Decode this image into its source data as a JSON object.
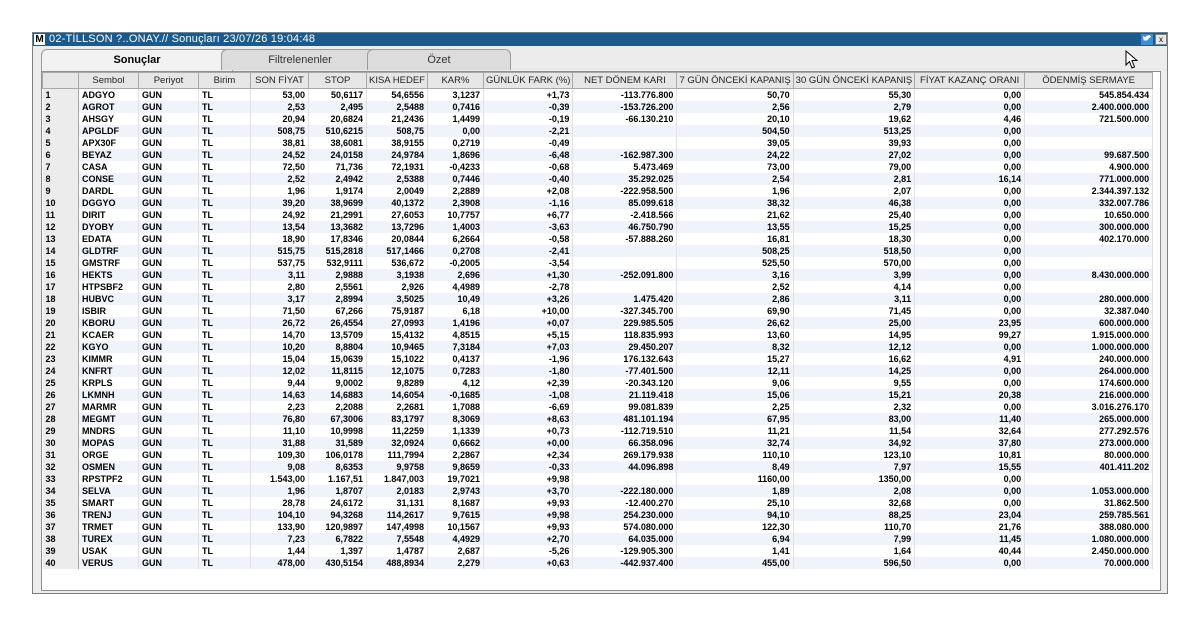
{
  "window": {
    "logo": "M",
    "title": "02-TİLLSON ?..ONAY.// Sonuçları  23/07/26 19:04:48",
    "close": "x"
  },
  "tabs": [
    {
      "label": "Sonuçlar",
      "active": true
    },
    {
      "label": "Filtrelenenler",
      "active": false
    },
    {
      "label": "Özet",
      "active": false
    }
  ],
  "columns": [
    "",
    "Sembol",
    "Periyot",
    "Birim",
    "SON FİYAT",
    "STOP",
    "KISA HEDEF",
    "KAR%",
    "GÜNLÜK FARK (%)",
    "NET DÖNEM KARI",
    "7 GÜN ÖNCEKİ KAPANIŞ",
    "30 GÜN ÖNCEKİ KAPANIŞ",
    "FİYAT KAZANÇ ORANI",
    "ÖDENMİŞ SERMAYE"
  ],
  "rows": [
    [
      "1",
      "ADGYO",
      "GUN",
      "TL",
      "53,00",
      "50,6117",
      "54,6556",
      "3,1237",
      "+1,73",
      "-113.776.800",
      "50,70",
      "55,30",
      "0,00",
      "545.854.434"
    ],
    [
      "2",
      "AGROT",
      "GUN",
      "TL",
      "2,53",
      "2,495",
      "2,5488",
      "0,7416",
      "-0,39",
      "-153.726.200",
      "2,56",
      "2,79",
      "0,00",
      "2.400.000.000"
    ],
    [
      "3",
      "AHSGY",
      "GUN",
      "TL",
      "20,94",
      "20,6824",
      "21,2436",
      "1,4499",
      "-0,19",
      "-66.130.210",
      "20,10",
      "19,62",
      "4,46",
      "721.500.000"
    ],
    [
      "4",
      "APGLDF",
      "GUN",
      "TL",
      "508,75",
      "510,6215",
      "508,75",
      "0,00",
      "-2,21",
      "",
      "504,50",
      "513,25",
      "0,00",
      ""
    ],
    [
      "5",
      "APX30F",
      "GUN",
      "TL",
      "38,81",
      "38,6081",
      "38,9155",
      "0,2719",
      "-0,49",
      "",
      "39,05",
      "39,93",
      "0,00",
      ""
    ],
    [
      "6",
      "BEYAZ",
      "GUN",
      "TL",
      "24,52",
      "24,0158",
      "24,9784",
      "1,8696",
      "-6,48",
      "-162.987.300",
      "24,22",
      "27,02",
      "0,00",
      "99.687.500"
    ],
    [
      "7",
      "CASA",
      "GUN",
      "TL",
      "72,50",
      "71,736",
      "72,1931",
      "-0,4233",
      "-0,68",
      "5.473.469",
      "73,00",
      "79,00",
      "0,00",
      "4.900.000"
    ],
    [
      "8",
      "CONSE",
      "GUN",
      "TL",
      "2,52",
      "2,4942",
      "2,5388",
      "0,7446",
      "-0,40",
      "35.292.025",
      "2,54",
      "2,81",
      "16,14",
      "771.000.000"
    ],
    [
      "9",
      "DARDL",
      "GUN",
      "TL",
      "1,96",
      "1,9174",
      "2,0049",
      "2,2889",
      "+2,08",
      "-222.958.500",
      "1,96",
      "2,07",
      "0,00",
      "2.344.397.132"
    ],
    [
      "10",
      "DGGYO",
      "GUN",
      "TL",
      "39,20",
      "38,9699",
      "40,1372",
      "2,3908",
      "-1,16",
      "85.099.618",
      "38,32",
      "46,38",
      "0,00",
      "332.007.786"
    ],
    [
      "11",
      "DIRIT",
      "GUN",
      "TL",
      "24,92",
      "21,2991",
      "27,6053",
      "10,7757",
      "+6,77",
      "-2.418.566",
      "21,62",
      "25,40",
      "0,00",
      "10.650.000"
    ],
    [
      "12",
      "DYOBY",
      "GUN",
      "TL",
      "13,54",
      "13,3682",
      "13,7296",
      "1,4003",
      "-3,63",
      "46.750.790",
      "13,55",
      "15,25",
      "0,00",
      "300.000.000"
    ],
    [
      "13",
      "EDATA",
      "GUN",
      "TL",
      "18,90",
      "17,8346",
      "20,0844",
      "6,2664",
      "-0,58",
      "-57.888.260",
      "16,81",
      "18,30",
      "0,00",
      "402.170.000"
    ],
    [
      "14",
      "GLDTRF",
      "GUN",
      "TL",
      "515,75",
      "515,2818",
      "517,1466",
      "0,2708",
      "-2,41",
      "",
      "508,25",
      "518,50",
      "0,00",
      ""
    ],
    [
      "15",
      "GMSTRF",
      "GUN",
      "TL",
      "537,75",
      "532,9111",
      "536,672",
      "-0,2005",
      "-3,54",
      "",
      "525,50",
      "570,00",
      "0,00",
      ""
    ],
    [
      "16",
      "HEKTS",
      "GUN",
      "TL",
      "3,11",
      "2,9888",
      "3,1938",
      "2,696",
      "+1,30",
      "-252.091.800",
      "3,16",
      "3,99",
      "0,00",
      "8.430.000.000"
    ],
    [
      "17",
      "HTPSBF2",
      "GUN",
      "TL",
      "2,80",
      "2,5561",
      "2,926",
      "4,4989",
      "-2,78",
      "",
      "2,52",
      "4,14",
      "0,00",
      ""
    ],
    [
      "18",
      "HUBVC",
      "GUN",
      "TL",
      "3,17",
      "2,8994",
      "3,5025",
      "10,49",
      "+3,26",
      "1.475.420",
      "2,86",
      "3,11",
      "0,00",
      "280.000.000"
    ],
    [
      "19",
      "ISBIR",
      "GUN",
      "TL",
      "71,50",
      "67,266",
      "75,9187",
      "6,18",
      "+10,00",
      "-327.345.700",
      "69,90",
      "71,45",
      "0,00",
      "32.387.040"
    ],
    [
      "20",
      "KBORU",
      "GUN",
      "TL",
      "26,72",
      "26,4554",
      "27,0993",
      "1,4196",
      "+0,07",
      "229.985.505",
      "26,62",
      "25,00",
      "23,95",
      "600.000.000"
    ],
    [
      "21",
      "KCAER",
      "GUN",
      "TL",
      "14,70",
      "13,5709",
      "15,4132",
      "4,8515",
      "+5,15",
      "118.835.993",
      "13,60",
      "14,95",
      "99,27",
      "1.915.000.000"
    ],
    [
      "22",
      "KGYO",
      "GUN",
      "TL",
      "10,20",
      "8,8804",
      "10,9465",
      "7,3184",
      "+7,03",
      "29.450.207",
      "8,32",
      "12,12",
      "0,00",
      "1.000.000.000"
    ],
    [
      "23",
      "KIMMR",
      "GUN",
      "TL",
      "15,04",
      "15,0639",
      "15,1022",
      "0,4137",
      "-1,96",
      "176.132.643",
      "15,27",
      "16,62",
      "4,91",
      "240.000.000"
    ],
    [
      "24",
      "KNFRT",
      "GUN",
      "TL",
      "12,02",
      "11,8115",
      "12,1075",
      "0,7283",
      "-1,80",
      "-77.401.500",
      "12,11",
      "14,25",
      "0,00",
      "264.000.000"
    ],
    [
      "25",
      "KRPLS",
      "GUN",
      "TL",
      "9,44",
      "9,0002",
      "9,8289",
      "4,12",
      "+2,39",
      "-20.343.120",
      "9,06",
      "9,55",
      "0,00",
      "174.600.000"
    ],
    [
      "26",
      "LKMNH",
      "GUN",
      "TL",
      "14,63",
      "14,6883",
      "14,6054",
      "-0,1685",
      "-1,08",
      "21.119.418",
      "15,06",
      "15,21",
      "20,38",
      "216.000.000"
    ],
    [
      "27",
      "MARMR",
      "GUN",
      "TL",
      "2,23",
      "2,2088",
      "2,2681",
      "1,7088",
      "-6,69",
      "99.081.839",
      "2,25",
      "2,32",
      "0,00",
      "3.016.276.170"
    ],
    [
      "28",
      "MEGMT",
      "GUN",
      "TL",
      "76,80",
      "67,3006",
      "83,1797",
      "8,3069",
      "+8,63",
      "481.101.194",
      "67,95",
      "83,00",
      "11,40",
      "265.000.000"
    ],
    [
      "29",
      "MNDRS",
      "GUN",
      "TL",
      "11,10",
      "10,9998",
      "11,2259",
      "1,1339",
      "+0,73",
      "-112.719.510",
      "11,21",
      "11,54",
      "32,64",
      "277.292.576"
    ],
    [
      "30",
      "MOPAS",
      "GUN",
      "TL",
      "31,88",
      "31,589",
      "32,0924",
      "0,6662",
      "+0,00",
      "66.358.096",
      "32,74",
      "34,92",
      "37,80",
      "273.000.000"
    ],
    [
      "31",
      "ORGE",
      "GUN",
      "TL",
      "109,30",
      "106,0178",
      "111,7994",
      "2,2867",
      "+2,34",
      "269.179.938",
      "110,10",
      "123,10",
      "10,81",
      "80.000.000"
    ],
    [
      "32",
      "OSMEN",
      "GUN",
      "TL",
      "9,08",
      "8,6353",
      "9,9758",
      "9,8659",
      "-0,33",
      "44.096.898",
      "8,49",
      "7,97",
      "15,55",
      "401.411.202"
    ],
    [
      "33",
      "RPSTPF2",
      "GUN",
      "TL",
      "1.543,00",
      "1.167,51",
      "1.847,003",
      "19,7021",
      "+9,98",
      "",
      "1160,00",
      "1350,00",
      "0,00",
      ""
    ],
    [
      "34",
      "SELVA",
      "GUN",
      "TL",
      "1,96",
      "1,8707",
      "2,0183",
      "2,9743",
      "+3,70",
      "-222.180.000",
      "1,89",
      "2,08",
      "0,00",
      "1.053.000.000"
    ],
    [
      "35",
      "SMART",
      "GUN",
      "TL",
      "28,78",
      "24,6172",
      "31,131",
      "8,1687",
      "+9,93",
      "-12.400.270",
      "25,10",
      "32,68",
      "0,00",
      "31.862.500"
    ],
    [
      "36",
      "TRENJ",
      "GUN",
      "TL",
      "104,10",
      "94,3268",
      "114,2617",
      "9,7615",
      "+9,98",
      "254.230.000",
      "94,10",
      "88,25",
      "23,04",
      "259.785.561"
    ],
    [
      "37",
      "TRMET",
      "GUN",
      "TL",
      "133,90",
      "120,9897",
      "147,4998",
      "10,1567",
      "+9,93",
      "574.080.000",
      "122,30",
      "110,70",
      "21,76",
      "388.080.000"
    ],
    [
      "38",
      "TUREX",
      "GUN",
      "TL",
      "7,23",
      "6,7822",
      "7,5548",
      "4,4929",
      "+2,70",
      "64.035.000",
      "6,94",
      "7,99",
      "11,45",
      "1.080.000.000"
    ],
    [
      "39",
      "USAK",
      "GUN",
      "TL",
      "1,44",
      "1,397",
      "1,4787",
      "2,687",
      "-5,26",
      "-129.905.300",
      "1,41",
      "1,64",
      "40,44",
      "2.450.000.000"
    ],
    [
      "40",
      "VERUS",
      "GUN",
      "TL",
      "478,00",
      "430,5154",
      "488,8934",
      "2,279",
      "+0,63",
      "-442.937.400",
      "455,00",
      "596,50",
      "0,00",
      "70.000.000"
    ]
  ]
}
